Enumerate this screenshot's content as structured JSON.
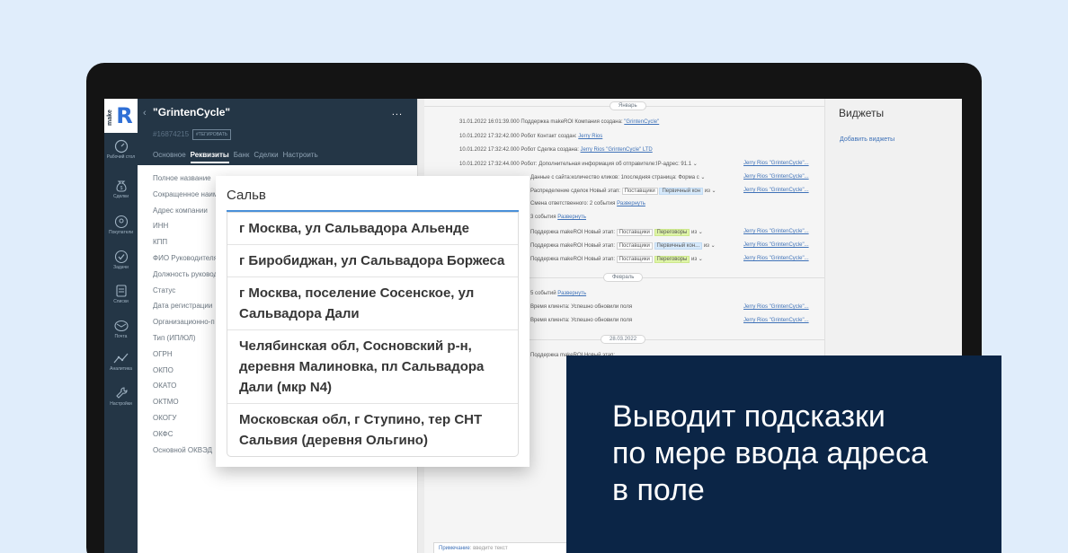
{
  "nav": {
    "logo_small": "make",
    "logo_letter": "R",
    "items": [
      {
        "label": "Рабочий стол",
        "icon": "dashboard-icon"
      },
      {
        "label": "Сделки",
        "icon": "money-bag-icon"
      },
      {
        "label": "Покупатели",
        "icon": "customers-icon"
      },
      {
        "label": "Задачи",
        "icon": "tasks-check-icon"
      },
      {
        "label": "Списки",
        "icon": "lists-icon"
      },
      {
        "label": "Почта",
        "icon": "mail-icon"
      },
      {
        "label": "Аналитика",
        "icon": "analytics-icon"
      },
      {
        "label": "Настройки",
        "icon": "settings-wrench-icon"
      }
    ]
  },
  "card": {
    "title": "\"GrintenCycle\"",
    "id": "#16874215",
    "tag_button": "#ТЕГИРОВАТЬ",
    "menu": "...",
    "tabs": [
      {
        "label": "Основное",
        "active": false
      },
      {
        "label": "Реквизиты",
        "active": true
      },
      {
        "label": "Банк",
        "active": false
      },
      {
        "label": "Сделки",
        "active": false
      },
      {
        "label": "Настроить",
        "active": false
      }
    ],
    "fields": [
      "Полное название",
      "Сокращенное наим",
      "Адрес компании",
      "ИНН",
      "КПП",
      "ФИО Руководителя",
      "Должность руковод",
      "Статус",
      "Дата регистрации",
      "Организационно-п",
      "Тип (ИП/ЮЛ)",
      "ОГРН",
      "ОКПО",
      "ОКАТО",
      "ОКТМО",
      "ОКОГУ",
      "ОКФС",
      "Основной ОКВЭД"
    ]
  },
  "feed": {
    "months": [
      "Январь",
      "Февраль",
      "28.03.2022"
    ],
    "events": {
      "e1_text": "31.01.2022 16:01:39.000 Поддержка makeROI Компания создана:",
      "e1_link": "\"GrintenCycle\"",
      "e2_text": "10.01.2022 17:32:42.000 Робот Контакт создан:",
      "e2_link": "Jerry Rios",
      "e3_text": "10.01.2022 17:32:42.000 Робот Сделка создана:",
      "e3_link": "Jerry Rios \"GrintenCycle\" LTD",
      "e4_text": "10.01.2022 17:32:44.000 Робот: Дополнительная информация об отправителе:IP-адрес: 91.1 ⌄",
      "e5_text": "Данные с сайта:количество кликов: 1последняя страница: Форма с ⌄",
      "e6_text": "Распределение сделок Новый этап:",
      "e6_s1": "Поставщики",
      "e6_s2": "Первичный кон",
      "e6_s3": "из ⌄",
      "e7_text": "Смена ответственного: 2 события",
      "e7_link": "Развернуть",
      "e8_text": "3 события",
      "e8_link": "Развернуть",
      "e9_text": "Поддержка makeROI Новый этап:",
      "e9_s1": "Поставщики",
      "e9_s2": "Переговоры",
      "e9_s3": "из ⌄",
      "e10_text": "Поддержка makeROI Новый этап:",
      "e10_s1": "Поставщики",
      "e10_s2": "Первичный кон...",
      "e10_s3": "из ⌄",
      "e11_text": "Поддержка makeROI Новый этап:",
      "e11_s1": "Поставщики",
      "e11_s2": "Переговоры",
      "e11_s3": "из ⌄",
      "e12_text": "5 событий",
      "e12_link": "Развернуть",
      "e13_text": "Время клиента: Успешно обновили поля",
      "e14_text": "Время клиента: Успешно обновили поля",
      "e15_text": "Поддержка makeROI Новый этап:"
    },
    "right_link": "Jerry Rios \"GrintenCycle\"...",
    "note_label": "Примечание",
    "note_placeholder": ": введите текст"
  },
  "widgets": {
    "title": "Виджеты",
    "add": "Добавить виджеты"
  },
  "popup": {
    "query": "Сальв",
    "suggestions": [
      "г Москва, ул Сальвадора Альенде",
      "г Биробиджан, ул Сальвадора Боржеса",
      "г Москва, поселение Сосенское, ул Сальвадора Дали",
      "Челябинская обл, Сосновский р-н, деревня Малиновка, пл Сальвадора Дали (мкр N4)",
      "Московская обл, г Ступино, тер СНТ Сальвия (деревня Ольгино)"
    ]
  },
  "overlay": {
    "line1": "Выводит подсказки",
    "line2": "по мере ввода адреса",
    "line3": "в поле"
  },
  "colors": {
    "background": "#e0edfb",
    "sidebar": "#243646",
    "overlay": "#0b2546",
    "link": "#3f72b8",
    "input_focus": "#4a90d9"
  }
}
